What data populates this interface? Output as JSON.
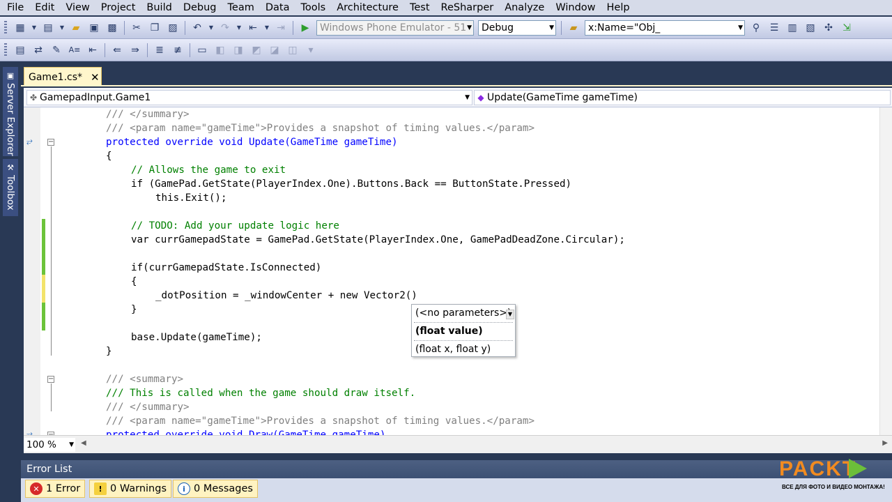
{
  "menu": [
    "File",
    "Edit",
    "View",
    "Project",
    "Build",
    "Debug",
    "Team",
    "Data",
    "Tools",
    "Architecture",
    "Test",
    "ReSharper",
    "Analyze",
    "Window",
    "Help"
  ],
  "toolbar": {
    "target_device": "Windows Phone Emulator - 51",
    "configuration": "Debug",
    "find_text": "x:Name=\"Obj_"
  },
  "side_tabs": {
    "server_explorer": "Server Explorer",
    "toolbox": "Toolbox"
  },
  "document_tab": {
    "title": "Game1.cs*",
    "close": "✕"
  },
  "navbar": {
    "type_combo": "GamepadInput.Game1",
    "member_combo": "Update(GameTime gameTime)"
  },
  "code_lines": [
    "/// </summary>",
    "/// <param name=\"gameTime\">Provides a snapshot of timing values.</param>",
    "protected override void Update(GameTime gameTime)",
    "{",
    "// Allows the game to exit",
    "if (GamePad.GetState(PlayerIndex.One).Buttons.Back == ButtonState.Pressed)",
    "this.Exit();",
    "",
    "// TODO: Add your update logic here",
    "var currGamepadState = GamePad.GetState(PlayerIndex.One, GamePadDeadZone.Circular);",
    "",
    "if(currGamepadState.IsConnected)",
    "{",
    "_dotPosition = _windowCenter + new Vector2()",
    "}",
    "",
    "base.Update(gameTime);",
    "}",
    "",
    "/// <summary>",
    "/// This is called when the game should draw itself.",
    "/// </summary>",
    "/// <param name=\"gameTime\">Provides a snapshot of timing values.</param>",
    "protected override void Draw(GameTime gameTime)"
  ],
  "param_popup": {
    "options": [
      "(<no parameters>)",
      "(float value)",
      "(float x, float y)"
    ]
  },
  "zoom": "100 %",
  "error_list": {
    "title": "Error List",
    "errors": "1 Error",
    "warnings": "0 Warnings",
    "messages": "0 Messages"
  },
  "watermark": {
    "brand": "PACKT",
    "tagline": "ВСЕ ДЛЯ ФОТО И ВИДЕО МОНТАЖА!"
  },
  "colors": {
    "keyword": "#0000ff",
    "type": "#2b91af",
    "comment": "#008000",
    "xmldoc": "#808080",
    "chrome": "#293955"
  }
}
